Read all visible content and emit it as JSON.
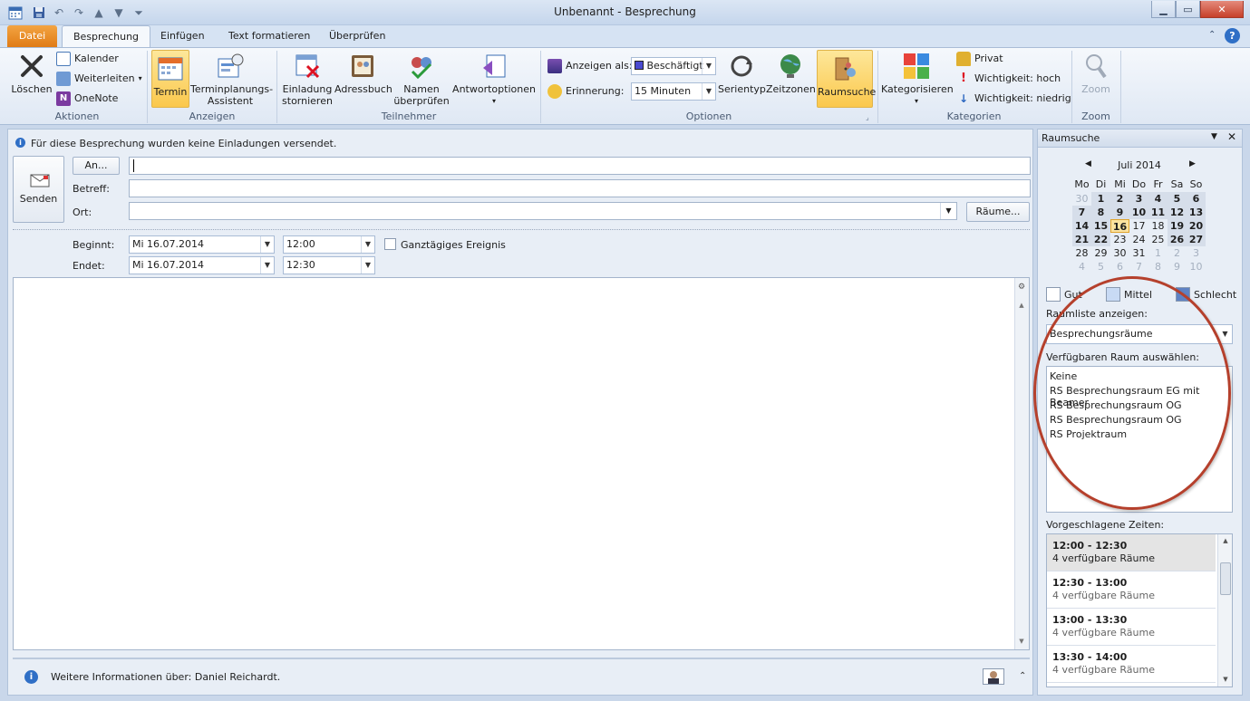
{
  "window": {
    "title": "Unbenannt  -  Besprechung",
    "min": "▁",
    "max": "▭",
    "close": "✕"
  },
  "tabs": [
    "Datei",
    "Besprechung",
    "Einfügen",
    "Text formatieren",
    "Überprüfen"
  ],
  "ribbon": {
    "aktionen": {
      "loeschen": "Löschen",
      "kalender": "Kalender",
      "weiterleiten": "Weiterleiten",
      "onenote": "OneNote",
      "label": "Aktionen"
    },
    "anzeigen": {
      "termin": "Termin",
      "assistent_1": "Terminplanungs-",
      "assistent_2": "Assistent",
      "label": "Anzeigen"
    },
    "teilnehmer": {
      "einladung_1": "Einladung",
      "einladung_2": "stornieren",
      "adressbuch": "Adressbuch",
      "namen_1": "Namen",
      "namen_2": "überprüfen",
      "antwort": "Antwortoptionen",
      "label": "Teilnehmer"
    },
    "optionen": {
      "anzeigen_als": "Anzeigen als:",
      "anzeigen_val": "Beschäftigt",
      "erinnerung": "Erinnerung:",
      "erinnerung_val": "15 Minuten",
      "serientyp": "Serientyp",
      "zeitzonen": "Zeitzonen",
      "raumsuche": "Raumsuche",
      "label": "Optionen"
    },
    "kategorien": {
      "kategorisieren": "Kategorisieren",
      "privat": "Privat",
      "hoch": "Wichtigkeit: hoch",
      "niedrig": "Wichtigkeit: niedrig",
      "label": "Kategorien"
    },
    "zoom": {
      "zoom": "Zoom",
      "label": "Zoom"
    }
  },
  "main": {
    "info": "Für diese Besprechung wurden keine Einladungen versendet.",
    "senden": "Senden",
    "an": "An...",
    "betreff": "Betreff:",
    "ort": "Ort:",
    "raeume": "Räume...",
    "beginnt": "Beginnt:",
    "endet": "Endet:",
    "start_date": "Mi 16.07.2014",
    "start_time": "12:00",
    "end_date": "Mi 16.07.2014",
    "end_time": "12:30",
    "ganztaegig": "Ganztägiges Ereignis",
    "footer": "Weitere Informationen über: Daniel Reichardt."
  },
  "raumsuche": {
    "title": "Raumsuche",
    "month": "Juli 2014",
    "weekdays": [
      "Mo",
      "Di",
      "Mi",
      "Do",
      "Fr",
      "Sa",
      "So"
    ],
    "weeks": [
      [
        "30",
        "1",
        "2",
        "3",
        "4",
        "5",
        "6"
      ],
      [
        "7",
        "8",
        "9",
        "10",
        "11",
        "12",
        "13"
      ],
      [
        "14",
        "15",
        "16",
        "17",
        "18",
        "19",
        "20"
      ],
      [
        "21",
        "22",
        "23",
        "24",
        "25",
        "26",
        "27"
      ],
      [
        "28",
        "29",
        "30",
        "31",
        "1",
        "2",
        "3"
      ],
      [
        "4",
        "5",
        "6",
        "7",
        "8",
        "9",
        "10"
      ]
    ],
    "legend": {
      "gut": "Gut",
      "mittel": "Mittel",
      "schlecht": "Schlecht"
    },
    "raumliste_label": "Raumliste anzeigen:",
    "raumliste_val": "Besprechungsräume",
    "raum_label": "Verfügbaren Raum auswählen:",
    "rooms": [
      "Keine",
      "RS Besprechungsraum EG mit Beamer",
      "RS Besprechungsraum OG",
      "RS Besprechungsraum OG",
      "RS Projektraum"
    ],
    "vorschlag_label": "Vorgeschlagene Zeiten:",
    "slots": [
      {
        "time": "12:00 - 12:30",
        "sub": "4 verfügbare Räume"
      },
      {
        "time": "12:30 - 13:00",
        "sub": "4 verfügbare Räume"
      },
      {
        "time": "13:00 - 13:30",
        "sub": "4 verfügbare Räume"
      },
      {
        "time": "13:30 - 14:00",
        "sub": "4 verfügbare Räume"
      }
    ]
  }
}
